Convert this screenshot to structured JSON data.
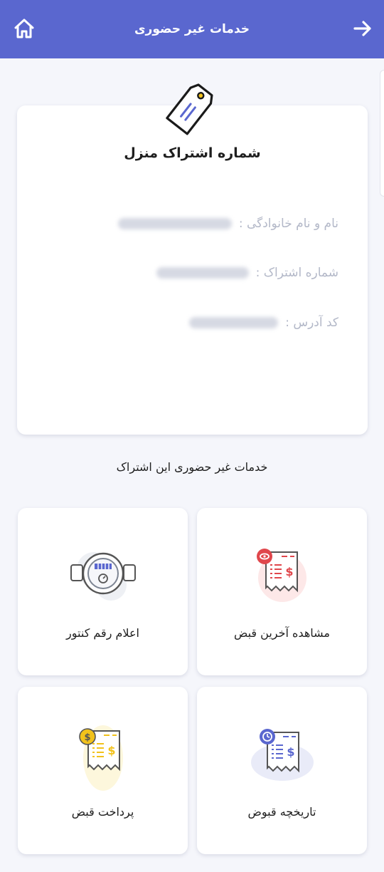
{
  "header": {
    "title": "خدمات غیر حضوری",
    "home_icon": "home-icon",
    "back_icon": "arrow-right-icon",
    "color": "#5a67cf"
  },
  "subscription": {
    "title": "شماره اشتراک منزل",
    "icon": "tag-icon",
    "name_label": "نام و نام خانوادگی :",
    "subscription_label": "شماره اشتراک :",
    "address_label": "کد آدرس :"
  },
  "services": {
    "section_title": "خدمات غیر حضوری این اشتراک",
    "items": [
      {
        "label": "مشاهده آخرین قبض",
        "icon": "view-bill-icon",
        "color": "#e0474c"
      },
      {
        "label": "اعلام رقم کنتور",
        "icon": "water-meter-icon",
        "color": "#7d8593"
      },
      {
        "label": "تاریخچه قبوض",
        "icon": "bill-history-icon",
        "color": "#5a67cf"
      },
      {
        "label": "پرداخت قبض",
        "icon": "pay-bill-icon",
        "color": "#f2c21b"
      }
    ]
  }
}
